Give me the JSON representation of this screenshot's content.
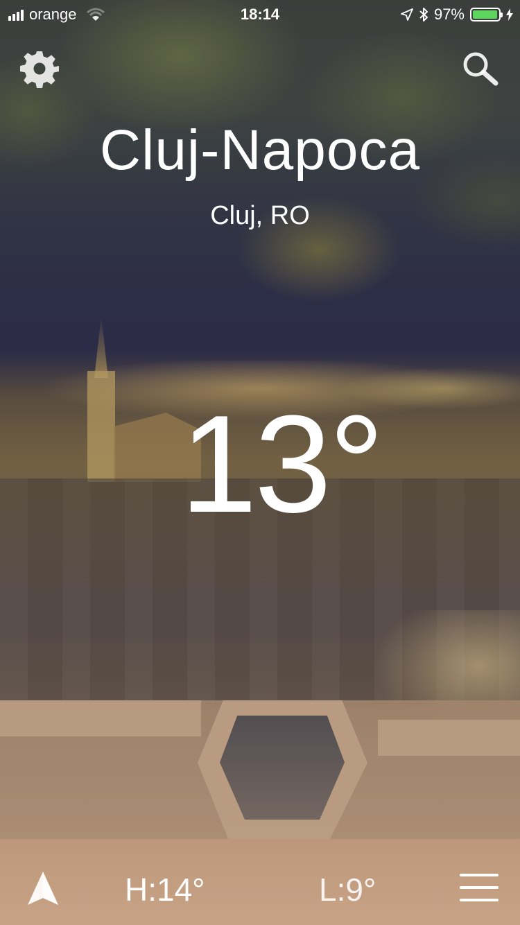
{
  "status_bar": {
    "carrier": "orange",
    "time": "18:14",
    "battery_percent": "97%",
    "battery_level": 0.97,
    "battery_color": "#5cd65c",
    "icons": [
      "signal-icon",
      "wifi-icon",
      "location-arrow-icon",
      "bluetooth-icon",
      "battery-icon",
      "charging-bolt-icon"
    ]
  },
  "header": {
    "settings_icon": "gear-icon",
    "search_icon": "search-icon"
  },
  "weather": {
    "city": "Cluj-Napoca",
    "region": "Cluj, RO",
    "temperature": "13°"
  },
  "footer": {
    "location_icon": "navigation-arrow-icon",
    "high": "H:14°",
    "low": "L:9°",
    "menu_icon": "hamburger-menu-icon"
  }
}
